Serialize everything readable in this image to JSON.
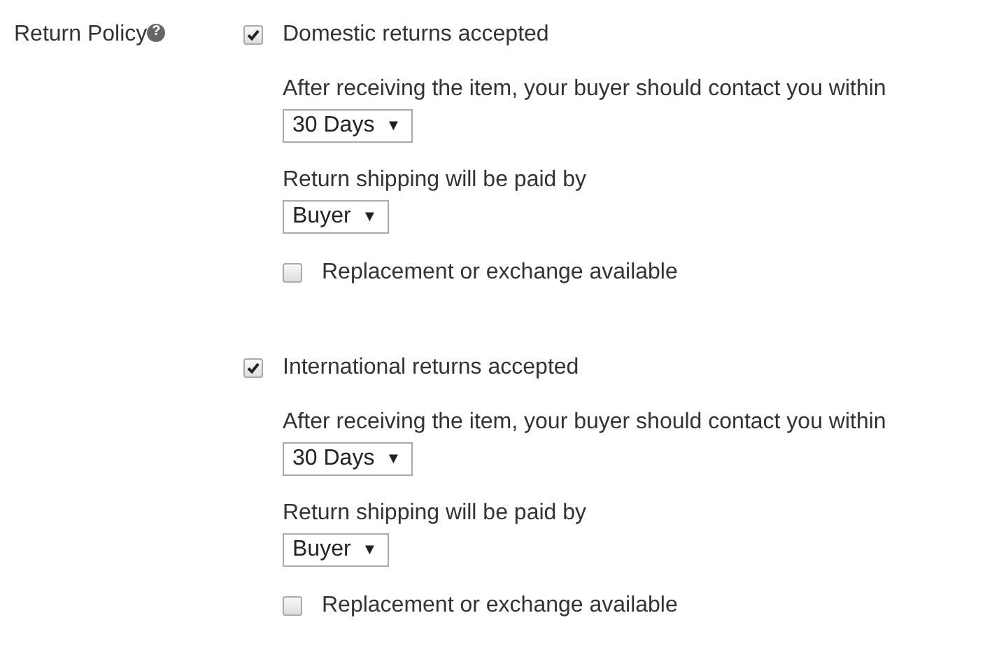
{
  "field_label": "Return Policy",
  "help_icon": "?",
  "sections": [
    {
      "label": "Domestic returns accepted",
      "checked": true,
      "contact_label": "After receiving the item, your buyer should contact you within",
      "contact_select": {
        "value": "30 Days",
        "caret": "▼"
      },
      "shipping_label": "Return shipping will be paid by",
      "shipping_select": {
        "value": "Buyer",
        "caret": "▼"
      },
      "replacement": {
        "label": "Replacement or exchange available",
        "checked": false
      }
    },
    {
      "label": "International returns accepted",
      "checked": true,
      "contact_label": "After receiving the item, your buyer should contact you within",
      "contact_select": {
        "value": "30 Days",
        "caret": "▼"
      },
      "shipping_label": "Return shipping will be paid by",
      "shipping_select": {
        "value": "Buyer",
        "caret": "▼"
      },
      "replacement": {
        "label": "Replacement or exchange available",
        "checked": false
      }
    }
  ]
}
